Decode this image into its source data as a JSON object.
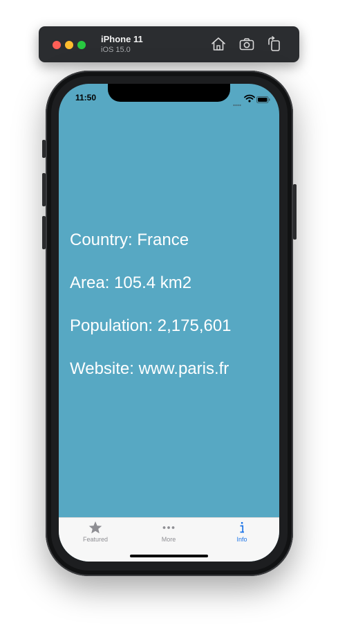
{
  "simulator": {
    "device_name": "iPhone 11",
    "os_version": "iOS 15.0",
    "toolbar_icons": [
      "home-icon",
      "screenshot-icon",
      "rotate-icon"
    ]
  },
  "status_bar": {
    "time": "11:50",
    "icons": [
      "cellular-signal-icon",
      "wifi-icon",
      "battery-icon"
    ]
  },
  "content": {
    "background_color": "#57a8c3",
    "text_color": "#ffffff",
    "lines": [
      "Country: France",
      "Area: 105.4 km2",
      "Population: 2,175,601",
      "Website: www.paris.fr"
    ]
  },
  "tab_bar": {
    "items": [
      {
        "label": "Featured",
        "icon": "star-icon",
        "selected": false
      },
      {
        "label": "More",
        "icon": "more-icon",
        "selected": false
      },
      {
        "label": "Info",
        "icon": "info-icon",
        "selected": true
      }
    ],
    "selected_color": "#1a73e8",
    "unselected_color": "#8e8e93"
  }
}
